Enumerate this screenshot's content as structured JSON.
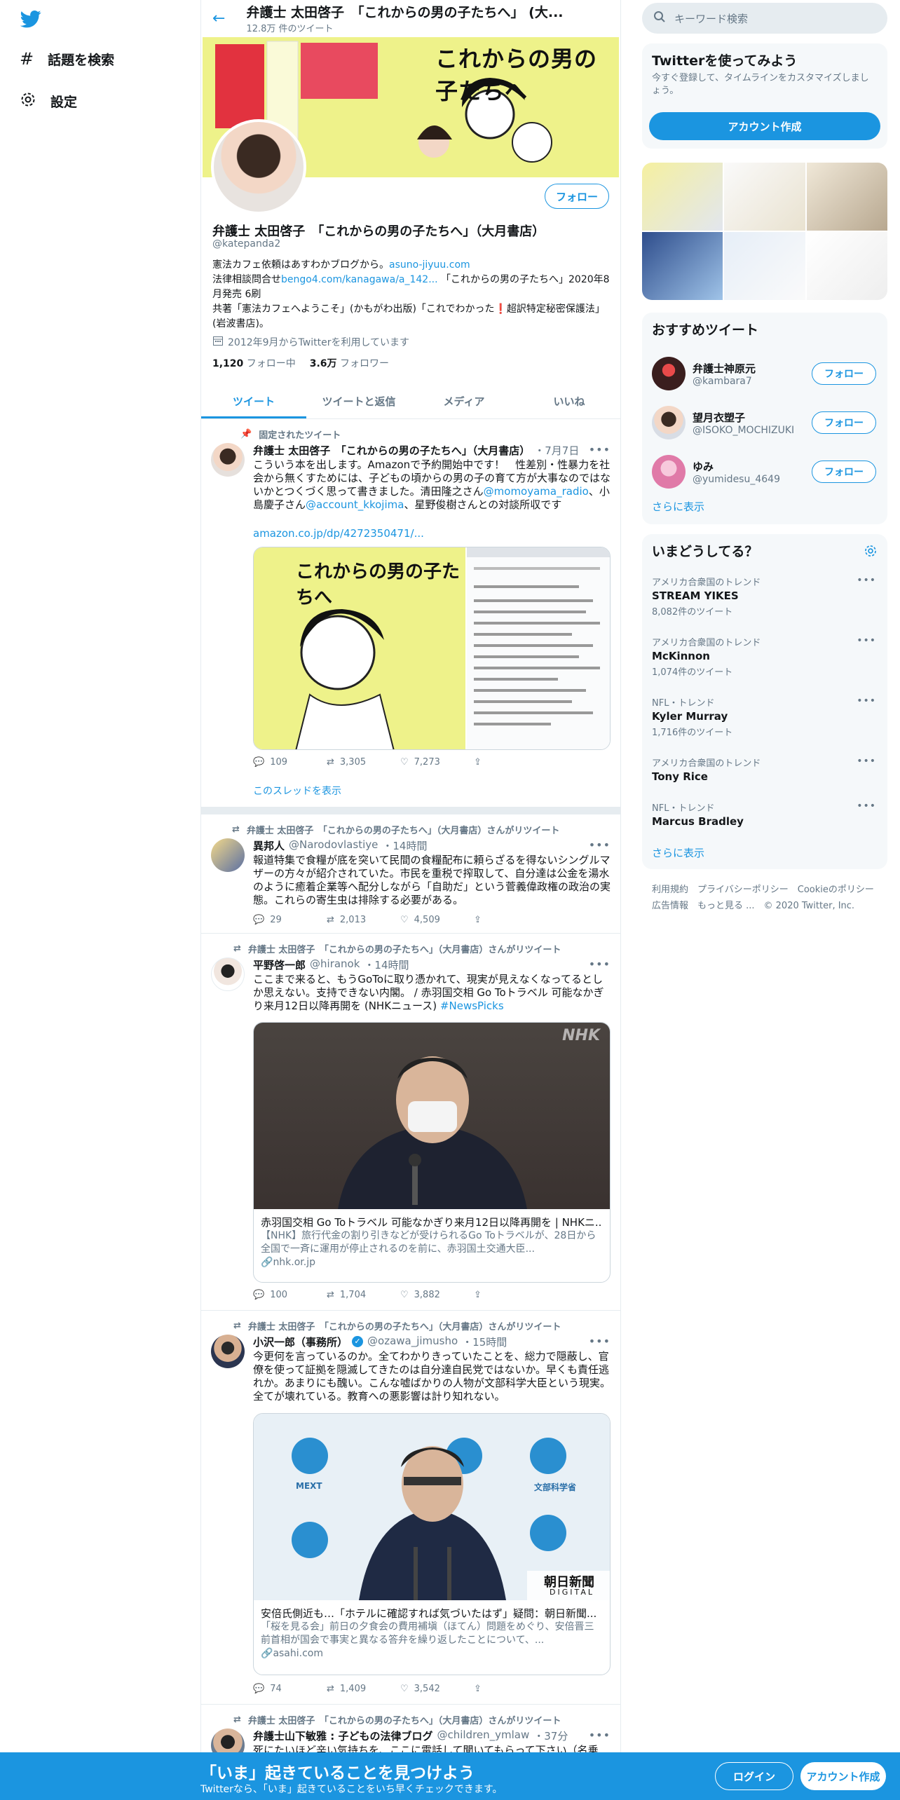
{
  "nav": {
    "explore": "話題を検索",
    "settings": "設定"
  },
  "header": {
    "title": "弁護士 太田啓子　「これからの男の子たちへ」 (大...",
    "tweet_count": "12.8万 件のツイート"
  },
  "profile": {
    "follow": "フォロー",
    "name": "弁護士 太田啓子　「これからの男の子たちへ」（大月書店）",
    "handle": "@katepanda2",
    "bio1_a": "憲法カフェ依頼はあすわかブログから。",
    "bio1_link": "asuno-jiyuu.com",
    "bio2_a": "法律相談問合せ",
    "bio2_link": "bengo4.com/kanagawa/a_142...",
    "bio2_b": " 「これからの男の子たちへ」2020年8月発売 6刷",
    "bio3": "共著「憲法カフェへようこそ」(かもがわ出版)「これでわかった❗️超訳特定秘密保護法」(岩波書店)。",
    "joined": "2012年9月からTwitterを利用しています",
    "following_num": "1,120",
    "following_label": "フォロー中",
    "followers_num": "3.6万",
    "followers_label": "フォロワー",
    "banner_title": "これからの男の子たちへ"
  },
  "tabs": [
    "ツイート",
    "ツイートと返信",
    "メディア",
    "いいね"
  ],
  "tweets": {
    "t1": {
      "context": "固定されたツイート",
      "name": "弁護士 太田啓子　「これからの男の子たちへ」（大月書店）",
      "date": "・7月7日",
      "text": "こういう本を出します。Amazonで予約開始中です！　性差別・性暴力を社会から無くすためには、子どもの頃からの男の子の育て方が大事なのではないかとつくづく思って書きました。清田隆之さん",
      "m1": "@momoyama_radio",
      "text2": "、小島慶子さん",
      "m2": "@account_kkojima",
      "text3": "、星野俊樹さんとの対談所収です",
      "link": "amazon.co.jp/dp/4272350471/...",
      "book_title": "これからの男の子たちへ",
      "replies": "109",
      "retweets": "3,305",
      "likes": "7,273",
      "thread": "このスレッドを表示"
    },
    "t2": {
      "context": "弁護士 太田啓子　「これからの男の子たちへ」（大月書店）さんがリツイート",
      "name": "異邦人",
      "handle": "@Narodovlastiye",
      "date": "・14時間",
      "text": "報道特集で食糧が底を突いて民間の食糧配布に頼らざるを得ないシングルマザーの方々が紹介されていた。市民を重税で搾取して、自分達は公金を湯水のように癒着企業等へ配分しながら「自助だ」という菅義偉政権の政治の実態。これらの寄生虫は排除する必要がある。",
      "replies": "29",
      "retweets": "2,013",
      "likes": "4,509"
    },
    "t3": {
      "context": "弁護士 太田啓子　「これからの男の子たちへ」（大月書店）さんがリツイート",
      "name": "平野啓一郎",
      "handle": "@hiranok",
      "date": "・14時間",
      "text": "ここまで来ると、もうGoToに取り憑かれて、現実が見えなくなってるとしか思えない。支持できない内閣。 / 赤羽国交相 Go Toトラベル 可能なかぎり来月12日以降再開を (NHKニュース) ",
      "tag": "#NewsPicks",
      "card_title": "赤羽国交相 Go Toトラベル 可能なかぎり来月12日以降再開を | NHKニ...",
      "card_desc": "【NHK】旅行代金の割り引きなどが受けられるGo Toトラベルが、28日から全国で一斉に運用が停止されるのを前に、赤羽国土交通大臣...",
      "card_domain": "nhk.or.jp",
      "watermark": "NHK",
      "replies": "100",
      "retweets": "1,704",
      "likes": "3,882"
    },
    "t4": {
      "context": "弁護士 太田啓子　「これからの男の子たちへ」（大月書店）さんがリツイート",
      "name": "小沢一郎（事務所）",
      "handle": "@ozawa_jimusho",
      "date": "・15時間",
      "text": "今更何を言っているのか。全てわかりきっていたことを、総力で隠蔽し、官僚を使って証拠を隠滅してきたのは自分達自民党ではないか。早くも責任逃れか。あまりにも醜い。こんな嘘ばかりの人物が文部科学大臣という現実。全てが壊れている。教育への悪影響は計り知れない。",
      "card_title": "安倍氏側近も…「ホテルに確認すれば気づいたはず」疑問：朝日新聞...",
      "card_desc": "「桜を見る会」前日の夕食会の費用補塡（ほてん）問題をめぐり、安倍晋三前首相が国会で事実と異なる答弁を繰り返したことについて、...",
      "card_domain": "asahi.com",
      "logo_text": "MEXT",
      "logo_text2": "文部科学省",
      "paper": "朝日新聞",
      "paper_sub": "DIGITAL",
      "replies": "74",
      "retweets": "1,409",
      "likes": "3,542"
    },
    "t5": {
      "context": "弁護士 太田啓子　「これからの男の子たちへ」（大月書店）さんがリツイート",
      "name": "弁護士山下敏雅 : 子どもの法律ブログ",
      "handle": "@children_ymlaw",
      "date": "・37分",
      "text": "死にたいほど辛い気持ちを、ここに電話して聞いてもらって下さい（名乗"
    }
  },
  "right": {
    "search_placeholder": "キーワード検索",
    "signup_title": "Twitterを使ってみよう",
    "signup_desc": "今すぐ登録して、タイムラインをカスタマイズしましょう。",
    "signup_btn": "アカウント作成",
    "rec_title": "おすすめツイート",
    "recs": [
      {
        "name": "弁護士神原元",
        "handle": "@kambara7",
        "btn": "フォロー"
      },
      {
        "name": "望月衣塑子",
        "handle": "@ISOKO_MOCHIZUKI",
        "btn": "フォロー"
      },
      {
        "name": "ゆみ",
        "handle": "@yumidesu_4649",
        "btn": "フォロー"
      }
    ],
    "more": "さらに表示",
    "trends_title": "いまどうしてる？",
    "trends": [
      {
        "cat": "アメリカ合衆国のトレンド",
        "name": "STREAM YIKES",
        "count": "8,082件のツイート"
      },
      {
        "cat": "アメリカ合衆国のトレンド",
        "name": "McKinnon",
        "count": "1,074件のツイート"
      },
      {
        "cat": "NFL・トレンド",
        "name": "Kyler Murray",
        "count": "1,716件のツイート"
      },
      {
        "cat": "アメリカ合衆国のトレンド",
        "name": "Tony Rice",
        "count": ""
      },
      {
        "cat": "NFL・トレンド",
        "name": "Marcus Bradley",
        "count": ""
      }
    ],
    "footer1": "利用規約　プライバシーポリシー　Cookieのポリシー",
    "footer2": "広告情報　もっと見る ...　© 2020 Twitter, Inc."
  },
  "bottom": {
    "title": "「いま」起きていることを見つけよう",
    "subtitle": "Twitterなら、「いま」起きていることをいち早くチェックできます。",
    "login": "ログイン",
    "signup": "アカウント作成"
  },
  "colors": {
    "accent": "#1b95e0",
    "bg_secondary": "#f5f8fa",
    "border": "#e6ecf0"
  }
}
